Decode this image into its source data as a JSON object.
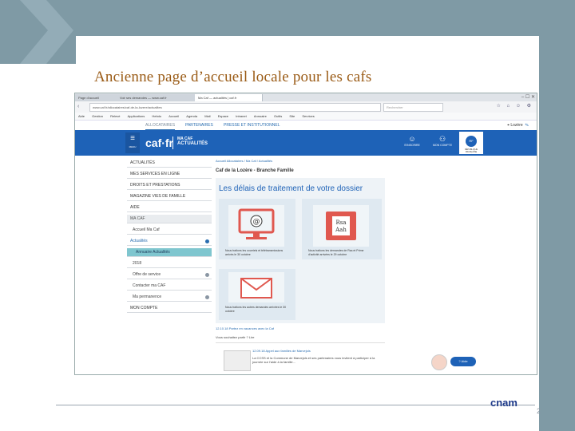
{
  "slide": {
    "title": "Ancienne page d’accueil locale pour les cafs",
    "page_number": "2",
    "footer_logo": "cnam"
  },
  "browser": {
    "tabs": [
      "Page d'accueil",
      "Voir ses demandes — www.caf.fr",
      "Ma Caf — actualités | caf.fr"
    ],
    "url": "www.caf.fr/allocataires/caf-de-la-lozere/actualites",
    "search_placeholder": "Rechercher",
    "favorites": [
      "Aide",
      "Gestion",
      "Relevé",
      "Applications",
      "Hebdo",
      "Accueil",
      "Agenda",
      "Mail",
      "Espace",
      "Intranet",
      "Annuaire",
      "Outils",
      "Site",
      "Services"
    ]
  },
  "site": {
    "topnav": [
      "ALLOCATAIRES",
      "PARTENAIRES",
      "PRESSE ET INSTITUTIONNEL"
    ],
    "topnav_right": "Lozère",
    "menu_label": "MENU",
    "logo": "caf·fr",
    "brand_line1": "MA CAF",
    "brand_line2": "ACTUALITÉS",
    "header_icons": [
      {
        "label": "S'INSCRIRE",
        "icon": "user-icon"
      },
      {
        "label": "MON COMPTE",
        "icon": "account-icon"
      }
    ],
    "rf_label": "RÉPUBLIQUE FRANÇAISE",
    "rf_badge": "RF"
  },
  "sidebar": {
    "items": [
      {
        "label": "ACTUALITÉS",
        "type": "head"
      },
      {
        "label": "MES SERVICES EN LIGNE",
        "type": "head"
      },
      {
        "label": "DROITS ET PRESTATIONS",
        "type": "head"
      },
      {
        "label": "MAGAZINE VIES DE FAMILLE",
        "type": "head"
      },
      {
        "label": "AIDE",
        "type": "head"
      },
      {
        "label": "MA CAF",
        "type": "grey"
      },
      {
        "label": "Accueil Ma Caf",
        "type": "sub"
      },
      {
        "label": "Actualités",
        "type": "blue"
      },
      {
        "label": "Annuaire Actualités",
        "type": "active"
      },
      {
        "label": "2018",
        "type": "sub"
      },
      {
        "label": "Offre de service",
        "type": "sub"
      },
      {
        "label": "Contacter ma CAF",
        "type": "sub"
      },
      {
        "label": "Ma permanence",
        "type": "sub"
      },
      {
        "label": "MON COMPTE",
        "type": "head"
      }
    ]
  },
  "main": {
    "breadcrumb": "Accueil Allocataires / Ma Caf / Actualités",
    "subtitle": "Caf de la Lozère - Branche Famille",
    "big_title": "Les délais de traitement de votre dossier",
    "tiles": [
      {
        "caption": "Nous traitons les courriels et télétransmissions arrivés le 30 octobre",
        "icon": "monitor-at-icon"
      },
      {
        "caption": "Nous traitons les demandes de Rsa et Prime d'activité arrivées le 29 octobre",
        "icon": "folder-rsa-icon",
        "badge_line1": "Rsa",
        "badge_line2": "Aah"
      },
      {
        "caption": "Nous traitons les autres demandes arrivées le 30 octobre",
        "icon": "envelope-icon"
      }
    ],
    "news": [
      {
        "date": "12.10.18",
        "title": "Partez en vacances avec la Caf",
        "extra": "Vous souhaitez partir ? Lire"
      },
      {
        "date": "12.09.18",
        "title": "Appel aux familles de Marvejols",
        "body": "La CCSS et la Commune de Marvejols et ses partenaires vous invitent à participer à la journée sur l'aide à la famille..."
      }
    ],
    "help_label": "Aide"
  },
  "colors": {
    "slide_bg": "#7f9aa5",
    "title": "#9a5b16",
    "caf_blue": "#1e62b7",
    "active_teal": "#7fc6cf"
  }
}
